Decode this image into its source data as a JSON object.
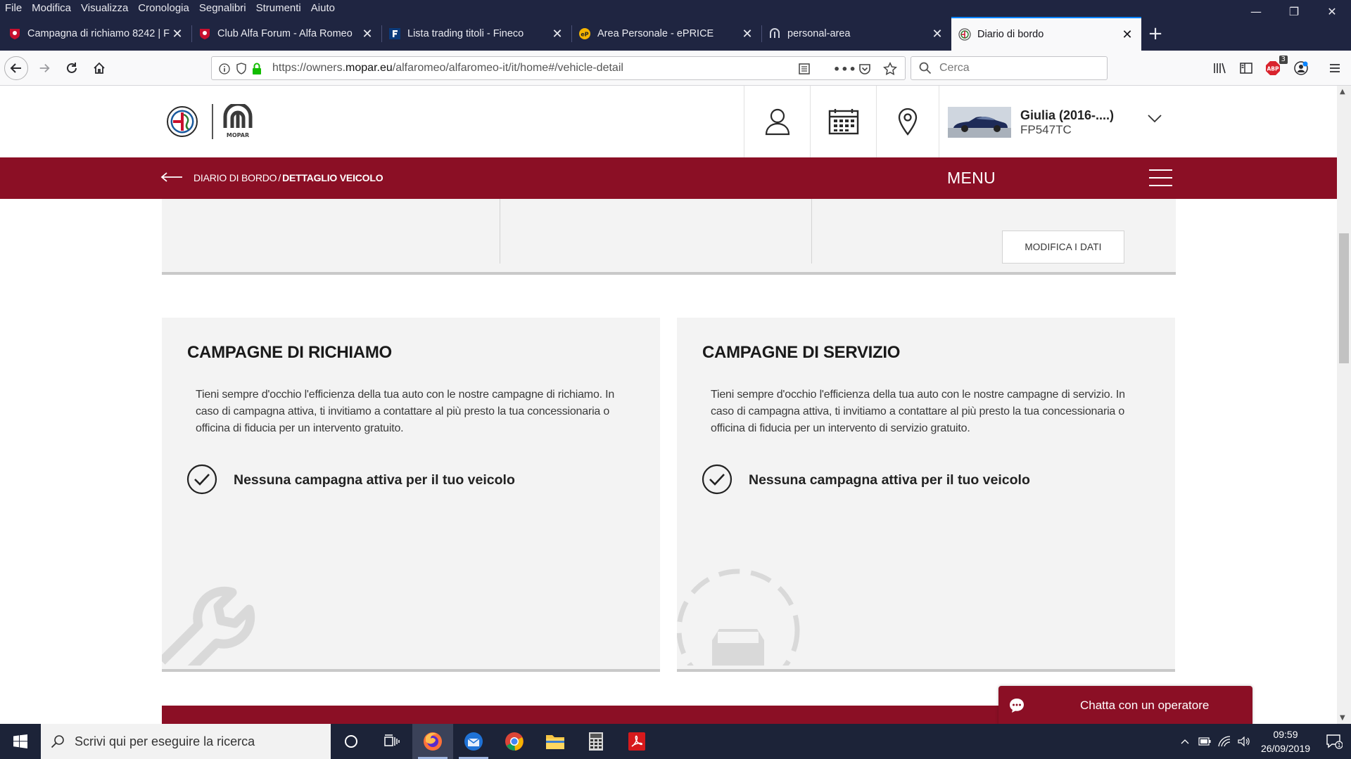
{
  "browser": {
    "menu": [
      "File",
      "Modifica",
      "Visualizza",
      "Cronologia",
      "Segnalibri",
      "Strumenti",
      "Aiuto"
    ],
    "tabs": [
      {
        "title": "Campagna di richiamo 8242 | F",
        "favicon": "alfa-forum-icon"
      },
      {
        "title": "Club Alfa Forum - Alfa Romeo",
        "favicon": "alfa-forum-icon"
      },
      {
        "title": "Lista trading titoli - Fineco",
        "favicon": "fineco-icon"
      },
      {
        "title": "Area Personale - ePRICE",
        "favicon": "eprice-icon"
      },
      {
        "title": "personal-area",
        "favicon": "mopar-icon"
      },
      {
        "title": "Diario di bordo",
        "favicon": "alfa-logo-icon",
        "active": true
      }
    ],
    "url_prefix": "https://owners.",
    "url_domain": "mopar.eu",
    "url_path": "/alfaromeo/alfaromeo-it/it/home#/vehicle-detail",
    "search_placeholder": "Cerca",
    "addon_badge": "3"
  },
  "site": {
    "vehicle": {
      "name": "Giulia (2016-....)",
      "plate": "FP547TC"
    },
    "breadcrumb": {
      "parent": "DIARIO DI BORDO",
      "separator": "/",
      "current": "DETTAGLIO VEICOLO"
    },
    "menu_label": "MENU",
    "edit_button": "MODIFICA I DATI",
    "recall": {
      "title": "CAMPAGNE DI RICHIAMO",
      "text": "Tieni sempre d'occhio l'efficienza della tua auto con le nostre campagne di richiamo. In caso di campagna attiva, ti invitiamo a contattare al più presto la tua concessionaria o officina di fiducia per un intervento gratuito.",
      "status": "Nessuna campagna attiva per il tuo veicolo"
    },
    "service": {
      "title": "CAMPAGNE DI SERVIZIO",
      "text": "Tieni sempre d'occhio l'efficienza della tua auto con le nostre campagne di servizio. In caso di campagna attiva, ti invitiamo a contattare al più presto la tua concessionaria o officina di fiducia per un intervento di servizio gratuito.",
      "status": "Nessuna campagna attiva per il tuo veicolo"
    },
    "chat_label": "Chatta con un operatore",
    "brand_color": "#8b0f25"
  },
  "taskbar": {
    "search_placeholder": "Scrivi qui per eseguire la ricerca",
    "time": "09:59",
    "date": "26/09/2019",
    "notification_count": "1"
  }
}
